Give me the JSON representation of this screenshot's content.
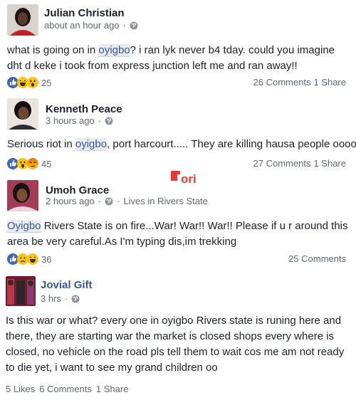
{
  "colors": {
    "accent": "#365899",
    "meta": "#616770",
    "text": "#1d2129",
    "like": "#4267b2",
    "angry": "#e9710f",
    "emoji": "#fcc419"
  },
  "posts": [
    {
      "name": "Julian Christian",
      "time": "about an hour ago",
      "text_before": "what is going on in ",
      "link": "oyigbo",
      "text_after": "? i ran lyk never b4 tday. could you imagine dht d keke i took from express junction left me and ran away!!",
      "reaction_icons": [
        "like-icon",
        "laugh-icon",
        "wow-icon"
      ],
      "reaction_count": "25",
      "comments": "26 Comments",
      "shares": "1 Share"
    },
    {
      "name": "Kenneth Peace",
      "time": "3 hours ago",
      "text_before": "Serious riot in ",
      "link": "oyigbo",
      "text_after": ", port harcourt..... They are killing hausa people ooooo",
      "reaction_icons": [
        "like-icon",
        "wow-icon",
        "angry-icon"
      ],
      "reaction_count": "45",
      "comments": "27 Comments",
      "shares": "1 Share"
    },
    {
      "name": "Umoh Grace",
      "time": "2 hours ago",
      "location": "Lives in Rivers State",
      "link": "Oyigbo",
      "text_after": " Rivers State is on fire...War! War!! War!! Please if u r around this area be very careful.As I'm typing dis,im trekking",
      "reaction_icons": [
        "like-icon",
        "sad-icon",
        "laugh-icon"
      ],
      "reaction_count": "36",
      "comments": "25 Comments"
    },
    {
      "name": "Jovial Gift",
      "time": "3 hrs",
      "text": "Is this war or what? every one in oyigbo Rivers state is runing here and there, they are starting war the market is closed shops every where is closed, no vehicle on the road pls tell them to wait cos me am not ready to die yet, i want to see my grand children oo",
      "likes": "5 Likes",
      "comments": "6 Comments",
      "shares": "1 Share"
    }
  ],
  "watermark": {
    "text": "ori"
  }
}
